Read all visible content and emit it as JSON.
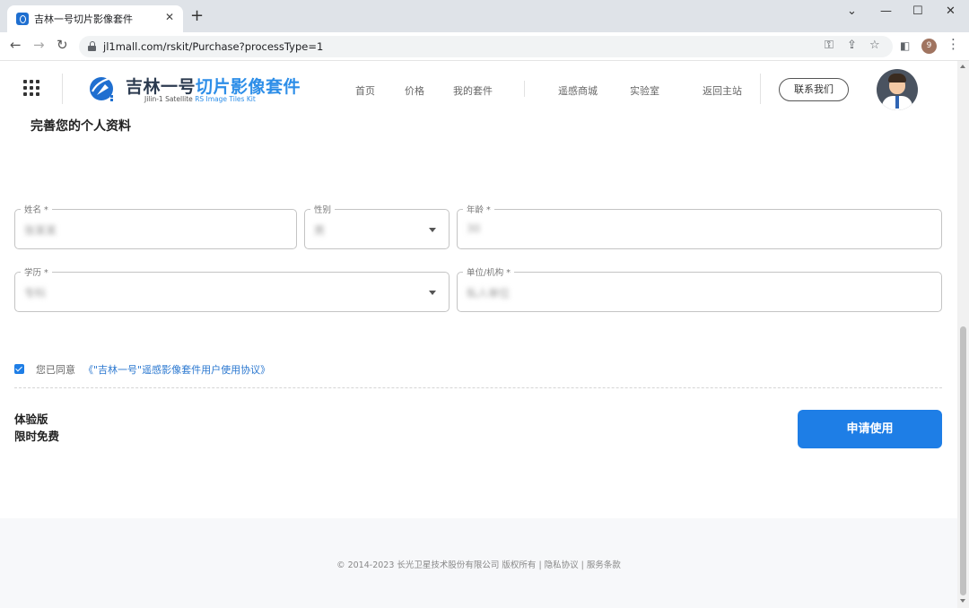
{
  "browser": {
    "tab_title": "吉林一号切片影像套件",
    "tab_close": "✕",
    "new_tab": "+",
    "url": "jl1mall.com/rskit/Purchase?processType=1",
    "profile_initial": "9",
    "window_controls": {
      "minimize": "—",
      "maximize": "☐",
      "close": "✕",
      "tab_search": "⌄"
    }
  },
  "header": {
    "logo_cn_dark": "吉林一号",
    "logo_cn_blue": "切片影像套件",
    "logo_en_dark": "Jilin-1  Satellite ",
    "logo_en_blue": "RS Image Tiles Kit",
    "nav": [
      {
        "label": "首页"
      },
      {
        "label": "价格"
      },
      {
        "label": "我的套件"
      },
      {
        "label": "遥感商城"
      },
      {
        "label": "实验室"
      },
      {
        "label": "返回主站"
      }
    ],
    "contact_label": "联系我们",
    "brand_color": "#2d8ee8"
  },
  "form": {
    "title": "完善您的个人资料",
    "fields": {
      "name": {
        "label": "姓名 *",
        "value": "张某某"
      },
      "gender": {
        "label": "性别",
        "value": "男"
      },
      "age": {
        "label": "年龄 *",
        "value": "30"
      },
      "education": {
        "label": "学历 *",
        "value": "专科"
      },
      "organization": {
        "label": "单位/机构 *",
        "value": "私人单位"
      }
    },
    "agreement": {
      "checked": true,
      "prefix": "您已同意",
      "link": "《\"吉林一号\"遥感影像套件用户使用协议》"
    }
  },
  "plan": {
    "name": "体验版",
    "price": "限时免费",
    "apply_label": "申请使用",
    "accent_color": "#1e7ee6"
  },
  "footer": {
    "text": "© 2014-2023 长光卫星技术股份有限公司 版权所有 | 隐私协议 | 服务条款"
  }
}
